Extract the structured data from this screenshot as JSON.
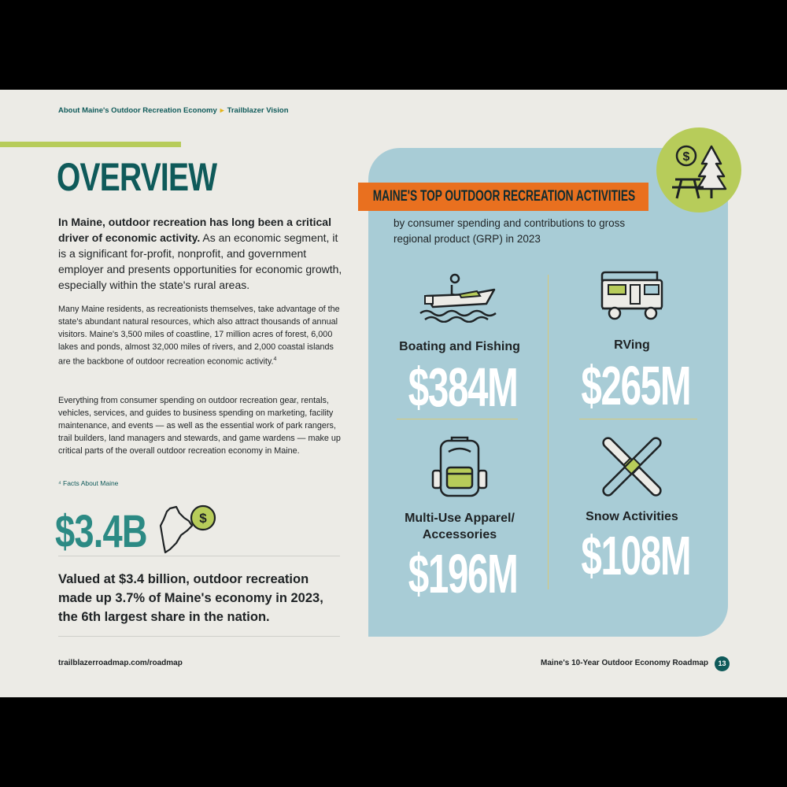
{
  "breadcrumb": {
    "item1": "About Maine's Outdoor Recreation Economy",
    "separator": "▸",
    "item2": "Trailblazer Vision"
  },
  "page_title": "OVERVIEW",
  "intro": {
    "bold": "In Maine, outdoor recreation has long been a critical driver of economic activity.",
    "rest": " As an economic segment, it is a significant for-profit, nonprofit, and government employer and presents opportunities for economic growth, especially within the state's rural areas."
  },
  "paragraph1": "Many Maine residents, as recreationists themselves, take advantage of the state's abundant natural resources, which also attract thousands of annual visitors. Maine's 3,500 miles of coastline, 17 million acres of forest, 6,000 lakes and ponds, almost 32,000 miles of rivers, and 2,000 coastal islands are the backbone of outdoor recreation economic activity.",
  "paragraph1_footnote_marker": "4",
  "paragraph2": "Everything from consumer spending on outdoor recreation gear, rentals, vehicles, services, and guides to business spending on marketing, facility maintenance, and events — as well as the essential work of park rangers, trail builders, land managers and stewards, and game wardens — make up critical parts of the overall outdoor recreation economy in Maine.",
  "footnote": "⁴ Facts About Maine",
  "highlight": {
    "value": "$3.4B",
    "statement": "Valued at $3.4 billion, outdoor recreation made up 3.7% of Maine's economy in 2023, the 6th largest share in the nation."
  },
  "panel": {
    "banner": "MAINE'S TOP OUTDOOR RECREATION ACTIVITIES",
    "subtitle": "by consumer spending and contributions to gross regional product (GRP) in 2023",
    "activities": [
      {
        "label": "Boating and Fishing",
        "value": "$384M",
        "icon": "boat-icon"
      },
      {
        "label": "RVing",
        "value": "$265M",
        "icon": "rv-icon"
      },
      {
        "label": "Multi-Use Apparel/ Accessories",
        "value": "$196M",
        "icon": "backpack-icon"
      },
      {
        "label": "Snow Activities",
        "value": "$108M",
        "icon": "skis-icon"
      }
    ]
  },
  "footer": {
    "url": "trailblazerroadmap.com/roadmap",
    "title": "Maine's 10-Year Outdoor Economy Roadmap",
    "page": "13"
  },
  "colors": {
    "teal": "#0f5a5a",
    "accent_green": "#b7cc5a",
    "panel_blue": "#a8ccd6",
    "banner_orange": "#e9701f"
  }
}
